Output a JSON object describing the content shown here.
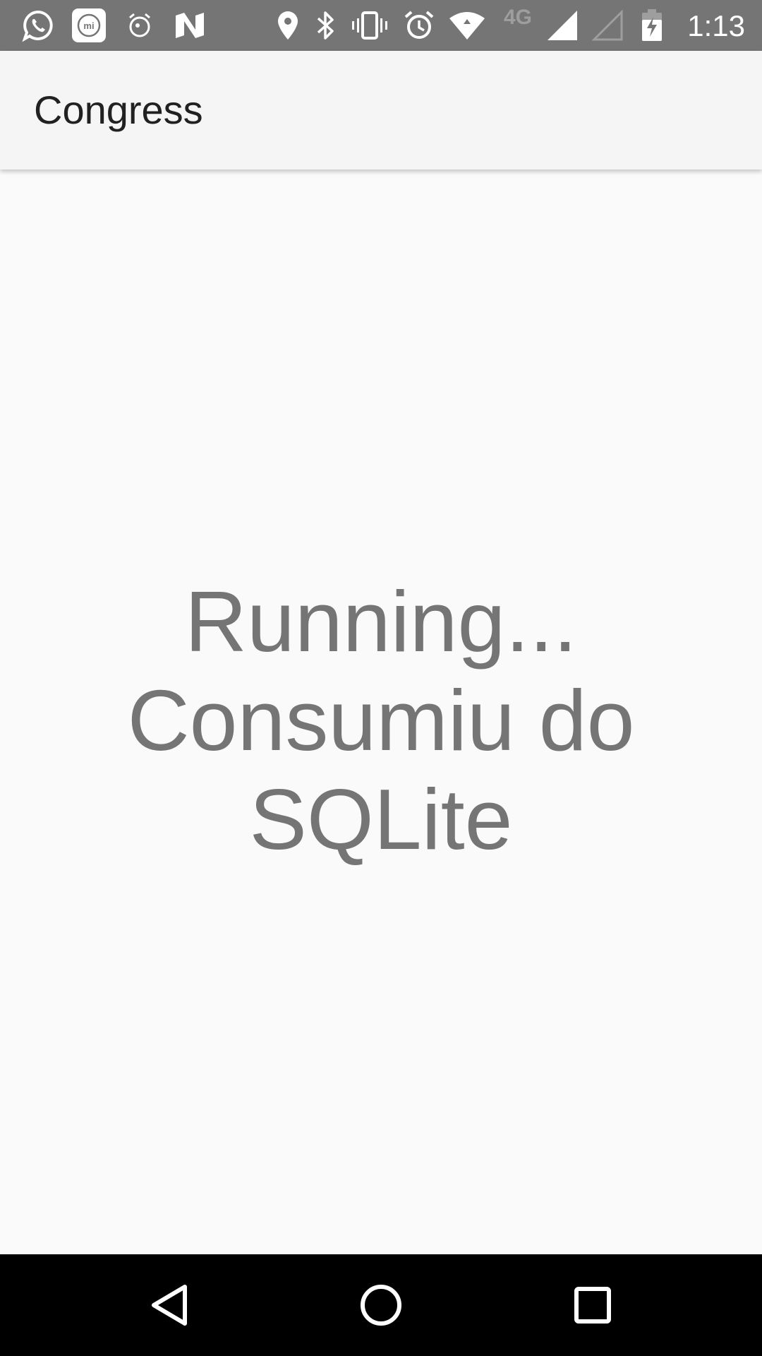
{
  "status_bar": {
    "time": "1:13",
    "network_type": "4G",
    "background_color": "#757575",
    "left_icons": [
      "whatsapp-icon",
      "mi-icon",
      "alarm-clock-icon",
      "n-logo-icon"
    ],
    "right_icons": [
      "location-icon",
      "bluetooth-icon",
      "vibrate-icon",
      "alarm-icon",
      "wifi-icon",
      "network-4g-icon",
      "signal-icon",
      "signal-empty-icon",
      "battery-charging-icon"
    ]
  },
  "app_bar": {
    "title": "Congress",
    "background_color": "#f5f5f5"
  },
  "main": {
    "message_lines": [
      "Running...",
      "Consumiu do",
      "SQLite"
    ],
    "text_color": "#757575"
  },
  "nav_bar": {
    "buttons": [
      "back-icon",
      "home-icon",
      "recents-icon"
    ],
    "background_color": "#000000"
  }
}
